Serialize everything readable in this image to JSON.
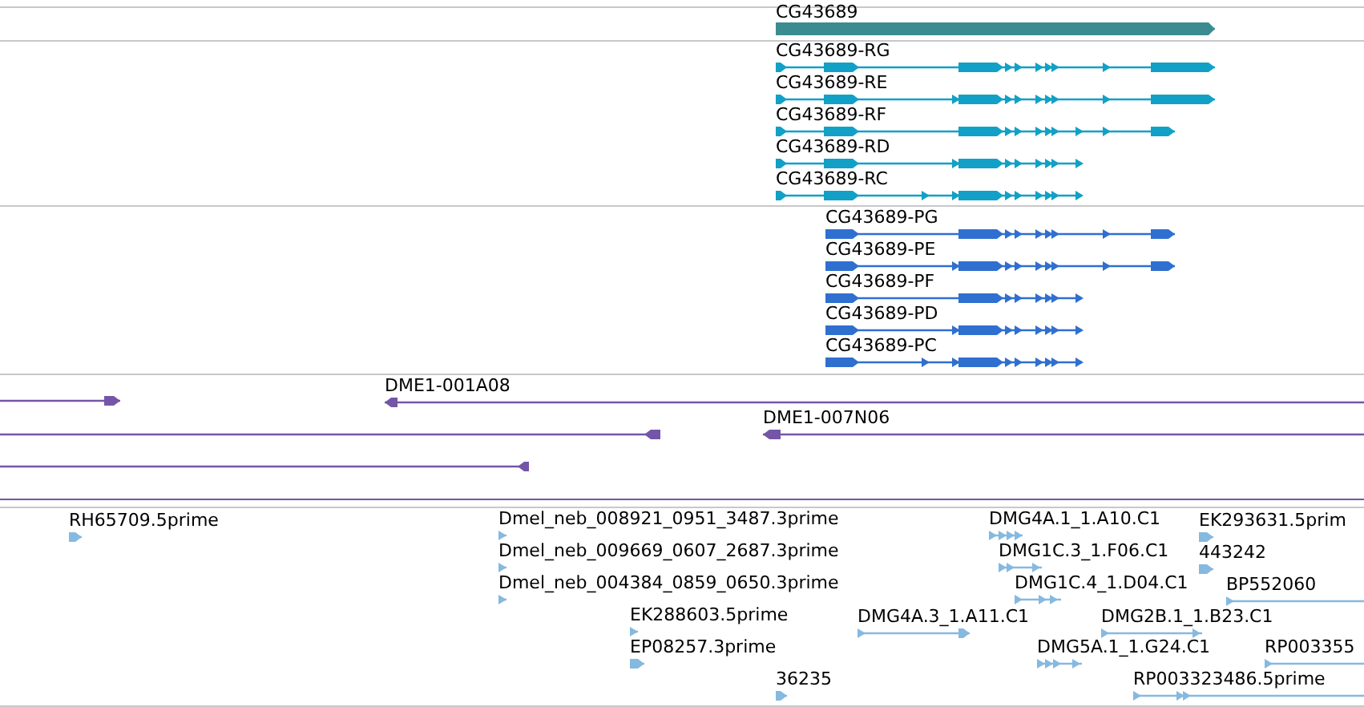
{
  "tracks": [
    {
      "kind": "gene",
      "features": [
        {
          "label": "CG43689"
        }
      ]
    },
    {
      "kind": "transcript",
      "features": [
        {
          "label": "CG43689-RG"
        },
        {
          "label": "CG43689-RE"
        },
        {
          "label": "CG43689-RF"
        },
        {
          "label": "CG43689-RD"
        },
        {
          "label": "CG43689-RC"
        }
      ]
    },
    {
      "kind": "protein",
      "features": [
        {
          "label": "CG43689-PG"
        },
        {
          "label": "CG43689-PE"
        },
        {
          "label": "CG43689-PF"
        },
        {
          "label": "CG43689-PD"
        },
        {
          "label": "CG43689-PC"
        }
      ]
    },
    {
      "kind": "clone",
      "features": [
        {
          "label": "DME1-001A08"
        },
        {
          "label": "DME1-007N06"
        }
      ]
    },
    {
      "kind": "est",
      "features": [
        {
          "label": "RH65709.5prime"
        },
        {
          "label": "Dmel_neb_008921_0951_3487.3prime"
        },
        {
          "label": "DMG4A.1_1.A10.C1"
        },
        {
          "label": "EK293631.5prim"
        },
        {
          "label": "Dmel_neb_009669_0607_2687.3prime"
        },
        {
          "label": "DMG1C.3_1.F06.C1"
        },
        {
          "label": "443242"
        },
        {
          "label": "Dmel_neb_004384_0859_0650.3prime"
        },
        {
          "label": "DMG1C.4_1.D04.C1"
        },
        {
          "label": "BP552060"
        },
        {
          "label": "EK288603.5prime"
        },
        {
          "label": "DMG4A.3_1.A11.C1"
        },
        {
          "label": "DMG2B.1_1.B23.C1"
        },
        {
          "label": "EP08257.3prime"
        },
        {
          "label": "DMG5A.1_1.G24.C1"
        },
        {
          "label": "RP003355"
        },
        {
          "label": "36235"
        },
        {
          "label": "RP003323486.5prime"
        }
      ]
    }
  ]
}
